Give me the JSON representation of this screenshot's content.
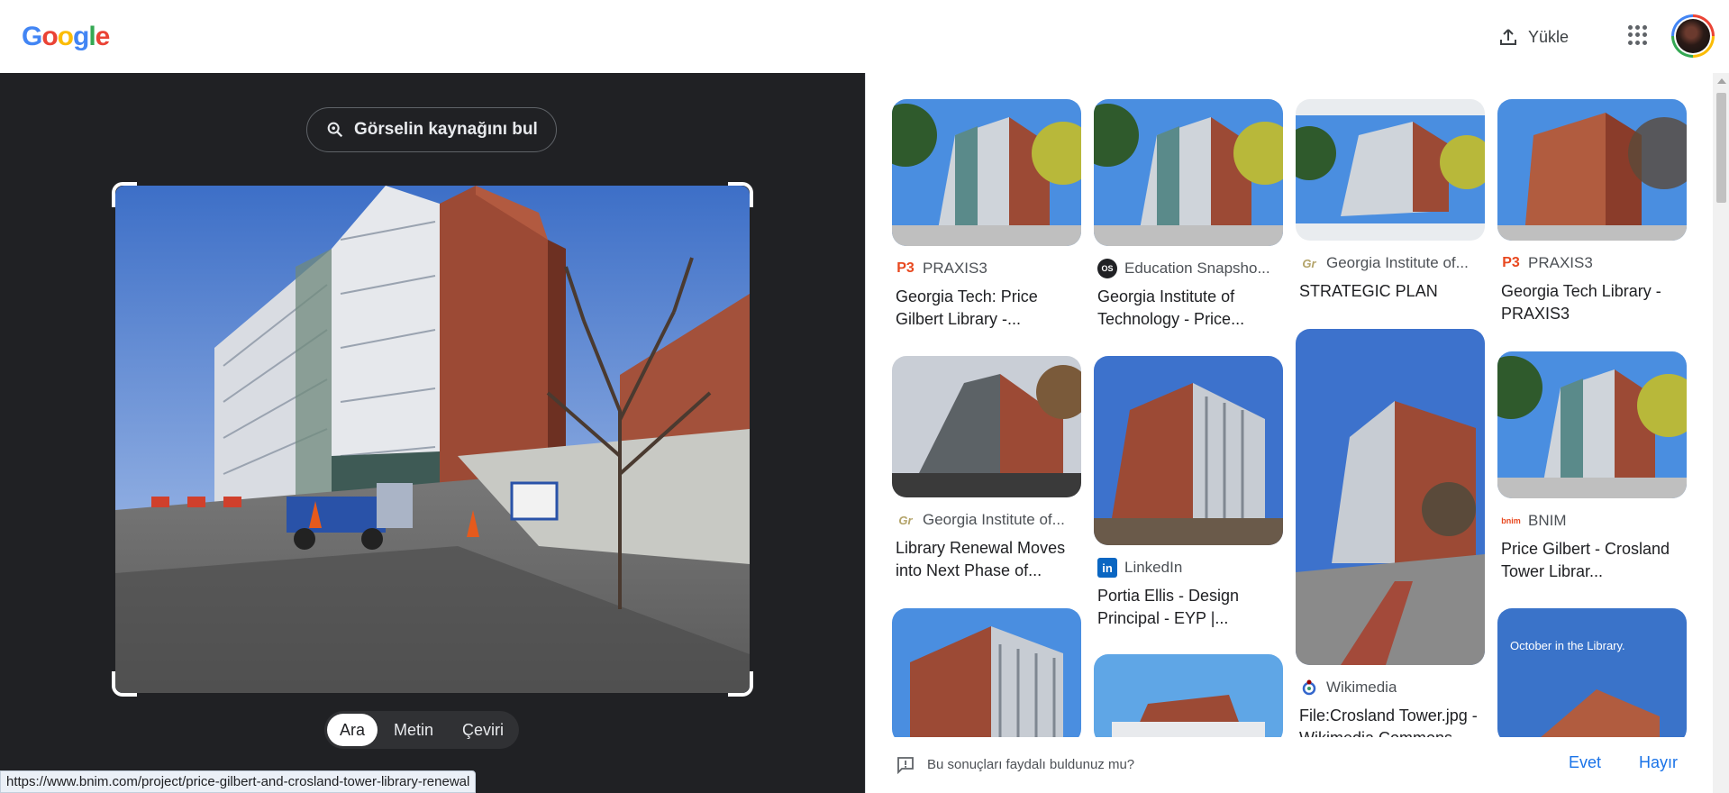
{
  "header": {
    "logo_letters": [
      "G",
      "o",
      "o",
      "g",
      "l",
      "e"
    ],
    "logo_colors": [
      "#4285f4",
      "#ea4335",
      "#fbbc05",
      "#4285f4",
      "#34a853",
      "#ea4335"
    ],
    "upload_label": "Yükle"
  },
  "lens": {
    "find_source_label": "Görselin kaynağını bul",
    "modes": [
      "Ara",
      "Metin",
      "Çeviri"
    ],
    "active_mode": "Ara"
  },
  "status_url": "https://www.bnim.com/project/price-gilbert-and-crosland-tower-library-renewal",
  "results": [
    {
      "source": "PRAXIS3",
      "source_icon": "praxis3-icon",
      "title": "Georgia Tech: Price Gilbert Library -..."
    },
    {
      "source": "Education Snapsho...",
      "source_icon": "os-icon",
      "title": "Georgia Institute of Technology - Price..."
    },
    {
      "source": "Georgia Institute of...",
      "source_icon": "gt-icon",
      "title": "STRATEGIC PLAN"
    },
    {
      "source": "PRAXIS3",
      "source_icon": "praxis3-icon",
      "title": "Georgia Tech Library - PRAXIS3"
    },
    {
      "source": "Georgia Institute of...",
      "source_icon": "gt-icon",
      "title": "Library Renewal Moves into Next Phase of..."
    },
    {
      "source": "LinkedIn",
      "source_icon": "linkedin-icon",
      "title": "Portia Ellis - Design Principal - EYP |..."
    },
    {
      "source": "Wikimedia",
      "source_icon": "wikimedia-icon",
      "title": "File:Crosland Tower.jpg - Wikimedia Commons"
    },
    {
      "source": "BNIM",
      "source_icon": "bnim-icon",
      "title": "Price Gilbert - Crosland Tower Librar..."
    }
  ],
  "thumb_caption_8": "October in the Library.",
  "feedback": {
    "question": "Bu sonuçları faydalı buldunuz mu?",
    "yes": "Evet",
    "no": "Hayır"
  },
  "colors": {
    "dark_bg": "#202124",
    "link_blue": "#1a73e8",
    "sky_blue": "#4a7fd4",
    "brick": "#9c4a35"
  }
}
